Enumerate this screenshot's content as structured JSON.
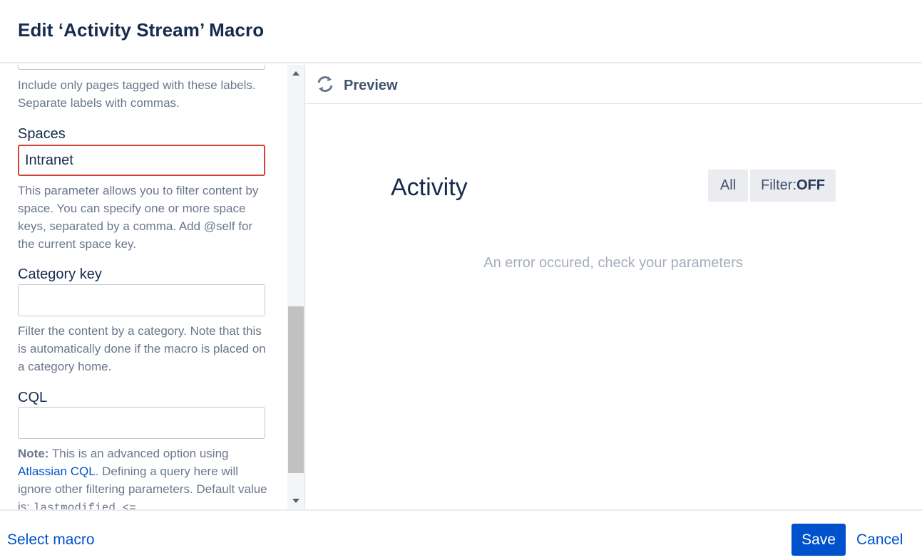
{
  "dialog": {
    "title": "Edit ‘Activity Stream’ Macro"
  },
  "params": {
    "labels_help": "Include only pages tagged with these labels. Separate labels with commas.",
    "spaces_label": "Spaces",
    "spaces_value": "Intranet",
    "spaces_help": "This parameter allows you to filter content by space. You can specify one or more space keys, separated by a comma. Add @self for the current space key.",
    "category_label": "Category key",
    "category_value": "",
    "category_help": "Filter the content by a category. Note that this is automatically done if the macro is placed on a category home.",
    "cql_label": "CQL",
    "cql_value": "",
    "cql_note_bold": "Note:",
    "cql_note_1": " This is an advanced option using ",
    "cql_link": "Atlassian CQL",
    "cql_note_2": ". Defining a query here will ignore other filtering parameters. Default value is: ",
    "cql_default_code": "lastmodified <="
  },
  "preview": {
    "title": "Preview",
    "refresh_icon": "refresh-icon",
    "activity_title": "Activity",
    "btn_all": "All",
    "btn_filter_prefix": "Filter:",
    "btn_filter_state": "OFF",
    "error": "An error occured, check your parameters"
  },
  "footer": {
    "select_macro": "Select macro",
    "save": "Save",
    "cancel": "Cancel"
  },
  "colors": {
    "primary": "#0052cc",
    "error_border": "#d04437",
    "text": "#172b4d",
    "muted": "#6b778c"
  }
}
